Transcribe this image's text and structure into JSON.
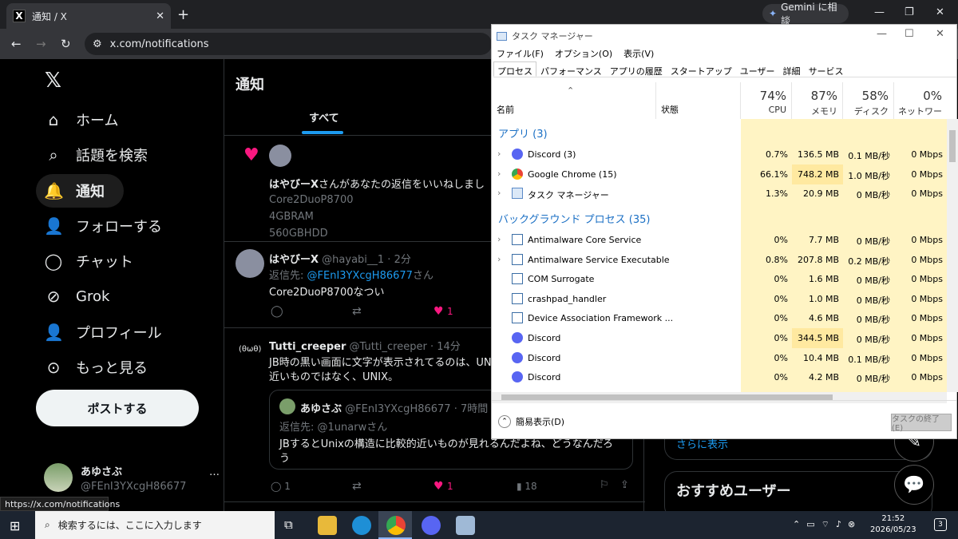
{
  "browser": {
    "tab_title": "通知 / X",
    "url": "x.com/notifications",
    "gemini_label": "Gemini に相談",
    "status_url": "https://x.com/notifications"
  },
  "x_nav": {
    "items": [
      {
        "icon": "home-icon",
        "label": "ホーム"
      },
      {
        "icon": "search-icon",
        "label": "話題を検索"
      },
      {
        "icon": "bell-icon",
        "label": "通知"
      },
      {
        "icon": "follow-icon",
        "label": "フォローする"
      },
      {
        "icon": "chat-icon",
        "label": "チャット"
      },
      {
        "icon": "grok-icon",
        "label": "Grok"
      },
      {
        "icon": "profile-icon",
        "label": "プロフィール"
      },
      {
        "icon": "more-icon",
        "label": "もっと見る"
      }
    ],
    "post_button": "ポストする",
    "account_name": "あゆさぶ",
    "account_handle": "@FEnI3YXcgH86677",
    "more": "…"
  },
  "main": {
    "title": "通知",
    "tab_all": "すべて",
    "n1": {
      "text_bold": "はやびーX",
      "text": "さんがあなたの返信をいいねしました",
      "lines": [
        "Core2DuoP8700",
        "4GBRAM",
        "560GBHDD"
      ]
    },
    "n2": {
      "name": "はやびーX",
      "handle": "@hayabi__1 · 2分",
      "reply_prefix": "返信先: ",
      "reply_user": "@FEnI3YXcgH86677",
      "reply_suffix": "さん",
      "body": "Core2DuoP8700なつい",
      "likes": "1"
    },
    "n3": {
      "avatar_text": "(θωθ)",
      "name": "Tutti_creeper",
      "handle": "@Tutti_creeper · 14分",
      "body1": "JB時の黒い画面に文字が表示されてるのは、UN",
      "body2": "近いものではなく、UNIX。",
      "quote_name": "あゆさぶ",
      "quote_handle": "@FEnI3YXcgH86677 · 7時間",
      "quote_reply": "返信先: @1unarwさん",
      "quote_body1": "JBするとUnixの構造に比較的近いものが見れるんだよね、どうなんだろ",
      "quote_body2": "う",
      "replies": "1",
      "likes": "1",
      "views": "18"
    }
  },
  "sidebar": {
    "show_more": "さらに表示",
    "recommend": "おすすめユーザー"
  },
  "taskmgr": {
    "title": "タスク マネージャー",
    "menu": [
      "ファイル(F)",
      "オプション(O)",
      "表示(V)"
    ],
    "tabs": [
      "プロセス",
      "パフォーマンス",
      "アプリの履歴",
      "スタートアップ",
      "ユーザー",
      "詳細",
      "サービス"
    ],
    "col_name": "名前",
    "col_status": "状態",
    "cols": [
      {
        "pct": "74%",
        "label": "CPU"
      },
      {
        "pct": "87%",
        "label": "メモリ"
      },
      {
        "pct": "58%",
        "label": "ディスク"
      },
      {
        "pct": "0%",
        "label": "ネットワーク"
      }
    ],
    "group_apps": "アプリ (3)",
    "group_bg": "バックグラウンド プロセス (35)",
    "apps": [
      {
        "name": "Discord (3)",
        "icon": "discord-icon",
        "cpu": "0.7%",
        "mem": "136.5 MB",
        "disk": "0.1 MB/秒",
        "net": "0 Mbps",
        "exp": true
      },
      {
        "name": "Google Chrome (15)",
        "icon": "chrome-icon",
        "cpu": "66.1%",
        "mem": "748.2 MB",
        "disk": "1.0 MB/秒",
        "net": "0 Mbps",
        "exp": true
      },
      {
        "name": "タスク マネージャー",
        "icon": "taskmgr-icon",
        "cpu": "1.3%",
        "mem": "20.9 MB",
        "disk": "0 MB/秒",
        "net": "0 Mbps",
        "exp": true
      }
    ],
    "bg": [
      {
        "name": "Antimalware Core Service",
        "icon": "service-icon",
        "cpu": "0%",
        "mem": "7.7 MB",
        "disk": "0 MB/秒",
        "net": "0 Mbps",
        "exp": true
      },
      {
        "name": "Antimalware Service Executable",
        "icon": "service-icon",
        "cpu": "0.8%",
        "mem": "207.8 MB",
        "disk": "0.2 MB/秒",
        "net": "0 Mbps",
        "exp": true
      },
      {
        "name": "COM Surrogate",
        "icon": "service-icon",
        "cpu": "0%",
        "mem": "1.6 MB",
        "disk": "0 MB/秒",
        "net": "0 Mbps",
        "exp": false
      },
      {
        "name": "crashpad_handler",
        "icon": "service-icon",
        "cpu": "0%",
        "mem": "1.0 MB",
        "disk": "0 MB/秒",
        "net": "0 Mbps",
        "exp": false
      },
      {
        "name": "Device Association Framework ...",
        "icon": "service-icon",
        "cpu": "0%",
        "mem": "4.6 MB",
        "disk": "0 MB/秒",
        "net": "0 Mbps",
        "exp": false
      },
      {
        "name": "Discord",
        "icon": "discord-icon",
        "cpu": "0%",
        "mem": "344.5 MB",
        "disk": "0 MB/秒",
        "net": "0 Mbps",
        "exp": false
      },
      {
        "name": "Discord",
        "icon": "discord-icon",
        "cpu": "0%",
        "mem": "10.4 MB",
        "disk": "0.1 MB/秒",
        "net": "0 Mbps",
        "exp": false
      },
      {
        "name": "Discord",
        "icon": "discord-icon",
        "cpu": "0%",
        "mem": "4.2 MB",
        "disk": "0 MB/秒",
        "net": "0 Mbps",
        "exp": false
      }
    ],
    "fewer_details": "簡易表示(D)",
    "end_task": "タスクの終了(E)"
  },
  "taskbar": {
    "search_placeholder": "検索するには、ここに入力します",
    "time": "21:52",
    "date": "2026/05/23",
    "notif_count": "3"
  },
  "colors": {
    "x_blue": "#1d9bf0",
    "heart": "#f91880",
    "cpu_high": "#f5a623",
    "cell_light": "#fff4c4",
    "cell_mid": "#ffe9a0"
  }
}
